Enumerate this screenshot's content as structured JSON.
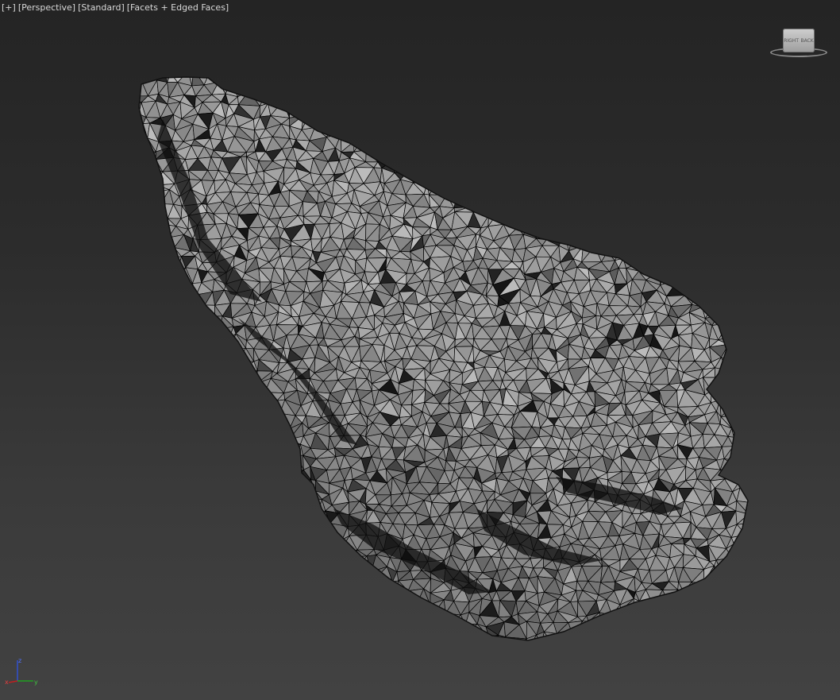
{
  "viewport": {
    "labels": {
      "menu": "[+]",
      "view": "[Perspective]",
      "shading": "[Standard]",
      "display": "[Facets + Edged Faces]"
    },
    "viewcube": {
      "left_face": "RIGHT",
      "right_face": "BACK"
    },
    "axis_tripod": {
      "z": "z",
      "x": "x",
      "y": "y"
    },
    "colors": {
      "background_top": "#242424",
      "background_bottom": "#424242",
      "mesh_face": "#9c9c9c",
      "mesh_edge": "#000000",
      "axis_x": "#c02020",
      "axis_y": "#20a020",
      "axis_z": "#3050d0"
    },
    "object": {
      "icon": "rock-mesh"
    }
  }
}
